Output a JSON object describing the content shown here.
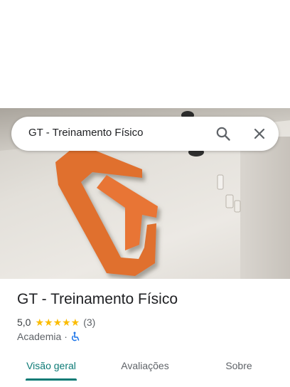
{
  "search": {
    "query": "GT - Treinamento Físico",
    "search_icon": "search-icon",
    "close_icon": "close-icon"
  },
  "hero": {
    "logo_color": "#e0702f"
  },
  "place": {
    "title": "GT - Treinamento Físico",
    "rating": "5,0",
    "stars": "★★★★★",
    "review_count": "(3)",
    "category": "Academia",
    "separator": "·",
    "accessibility_icon": "wheelchair-icon"
  },
  "tabs": [
    {
      "label": "Visão geral",
      "active": true
    },
    {
      "label": "Avaliações",
      "active": false
    },
    {
      "label": "Sobre",
      "active": false
    }
  ],
  "colors": {
    "accent": "#0b7a75",
    "star": "#fbbc04",
    "accessibility": "#1a73e8"
  }
}
